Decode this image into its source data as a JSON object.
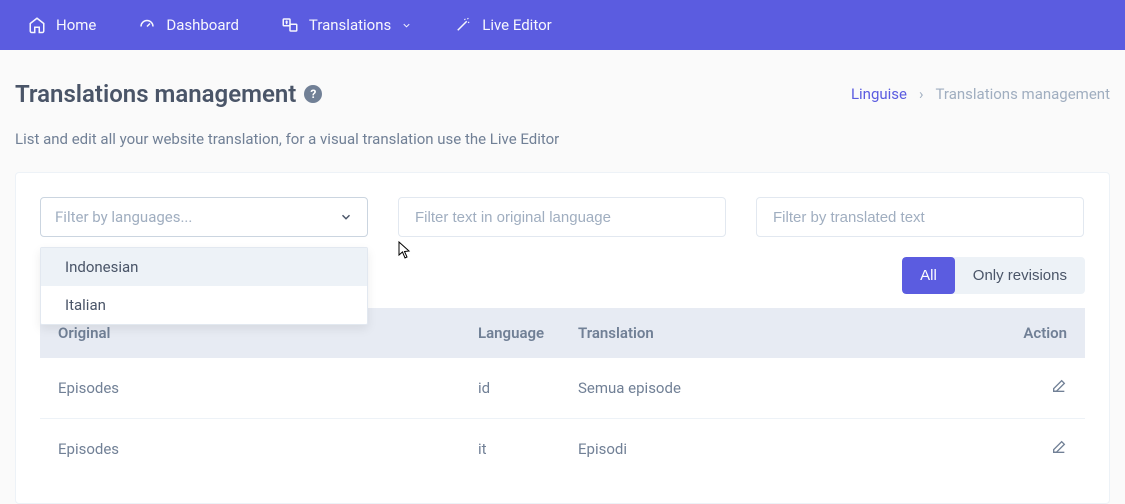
{
  "nav": {
    "items": [
      {
        "label": "Home",
        "icon": "home-icon"
      },
      {
        "label": "Dashboard",
        "icon": "dashboard-icon"
      },
      {
        "label": "Translations",
        "icon": "translations-icon",
        "chevron": true
      },
      {
        "label": "Live Editor",
        "icon": "wand-icon"
      }
    ]
  },
  "header": {
    "title": "Translations management",
    "help": "?",
    "breadcrumb": {
      "link": "Linguise",
      "sep": "›",
      "current": "Translations management"
    }
  },
  "subtitle": "List and edit all your website translation, for a visual translation use the Live Editor",
  "filters": {
    "lang_placeholder": "Filter by languages...",
    "dropdown_options": [
      "Indonesian",
      "Italian"
    ],
    "orig_placeholder": "Filter text in original language",
    "trans_placeholder": "Filter by translated text"
  },
  "toggle": {
    "all": "All",
    "revisions": "Only revisions"
  },
  "table": {
    "headers": {
      "original": "Original",
      "language": "Language",
      "translation": "Translation",
      "action": "Action"
    },
    "rows": [
      {
        "original": "Episodes",
        "language": "id",
        "translation": "Semua episode"
      },
      {
        "original": "Episodes",
        "language": "it",
        "translation": "Episodi"
      }
    ]
  }
}
